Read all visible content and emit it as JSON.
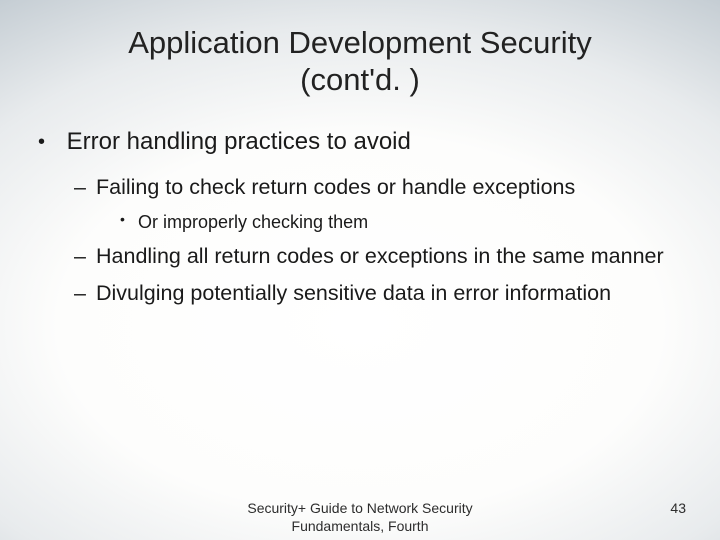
{
  "title_line1": "Application Development Security",
  "title_line2": "(cont'd. )",
  "bullets": {
    "lvl1": "Error handling practices to avoid",
    "lvl2_a": "Failing to check return codes or handle exceptions",
    "lvl3_a": "Or improperly checking them",
    "lvl2_b": "Handling all return codes or exceptions in the same manner",
    "lvl2_c": "Divulging potentially sensitive data in error information"
  },
  "footer": {
    "source": "Security+ Guide to Network Security Fundamentals, Fourth",
    "page": "43"
  }
}
